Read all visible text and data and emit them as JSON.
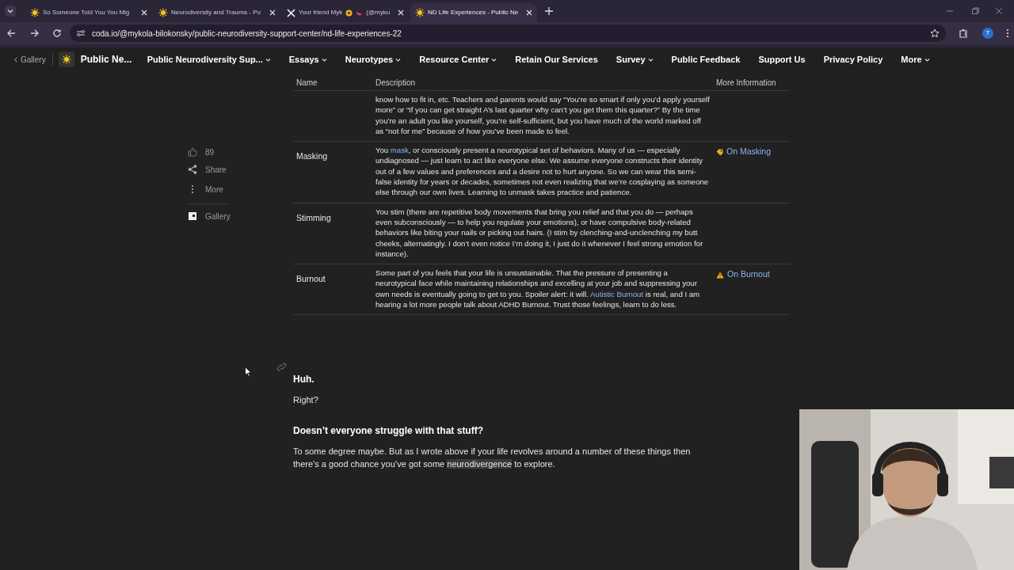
{
  "browser": {
    "tabs": [
      {
        "kind": "sun",
        "title": "So Someone Told You You Mig",
        "selected": false
      },
      {
        "kind": "sun",
        "title": "Neurodiversity and Trauma - Pu",
        "selected": false
      },
      {
        "kind": "x",
        "title": "Your friend Myk",
        "title_suffix": "(@myku",
        "selected": false
      },
      {
        "kind": "sun",
        "title": "ND Life Experiences - Public Ne",
        "selected": true
      }
    ],
    "url": "coda.io/@mykola-bilokonsky/public-neurodiversity-support-center/nd-life-experiences-22",
    "profile_initial": "T"
  },
  "nav": {
    "back_label": "Gallery",
    "doc_title": "Public Ne...",
    "items": [
      {
        "label": "Public Neurodiversity Sup...",
        "dropdown": true
      },
      {
        "label": "Essays",
        "dropdown": true
      },
      {
        "label": "Neurotypes",
        "dropdown": true
      },
      {
        "label": "Resource Center",
        "dropdown": true
      },
      {
        "label": "Retain Our Services",
        "dropdown": false
      },
      {
        "label": "Survey",
        "dropdown": true
      },
      {
        "label": "Public Feedback",
        "dropdown": false
      },
      {
        "label": "Support Us",
        "dropdown": false
      },
      {
        "label": "Privacy Policy",
        "dropdown": false
      },
      {
        "label": "More",
        "dropdown": true
      }
    ]
  },
  "side_actions": {
    "like_count": "89",
    "share": "Share",
    "more": "More",
    "gallery": "Gallery"
  },
  "table": {
    "columns": [
      "Name",
      "Description",
      "More Information"
    ],
    "rows": [
      {
        "description": [
          {
            "kind": "text",
            "text": "know how to fit in, etc. Teachers and parents would say “You’re so smart if only you’d apply yourself more” or “If you can get straight A’s last quarter why can’t you get them this quarter?” By the time you’re an adult you like yourself, you’re self-sufficient, but you have much of the world marked off as “not for me” because of how you’ve been made to feel."
          }
        ]
      },
      {
        "name": "Masking",
        "description": [
          {
            "kind": "text",
            "text": "You "
          },
          {
            "kind": "link",
            "text": "mask"
          },
          {
            "kind": "text",
            "text": ", or consciously present a neurotypical set of behaviors. Many of us — especially undiagnosed — just learn to act like everyone else. We assume everyone constructs their identity out of a few values and preferences and a desire not to hurt anyone. So we can wear this semi-false identity for years or decades, sometimes not even realizing that we’re cosplaying as someone else through our own lives. Learning to unmask takes practice and patience."
          }
        ],
        "info": {
          "kind": "tag",
          "label": "On Masking"
        }
      },
      {
        "name": "Stimming",
        "description": [
          {
            "kind": "text",
            "text": "You stim (there are repetitive body movements that bring you relief and that you do — perhaps even subconsciously — to help you regulate your emotions), or have compulsive body-related behaviors like biting your nails or picking out hairs. (I stim by clenching-and-unclenching my butt cheeks, alternatingly. I don’t even notice I’m doing it, I just do it whenever I feel strong emotion for instance)."
          }
        ]
      },
      {
        "name": "Burnout",
        "description": [
          {
            "kind": "text",
            "text": "Some part of you feels that your life is unsustainable. That the pressure of presenting a neurotypical face while maintaining relationships and excelling at your job and suppressing your own needs is eventually going to get to you. Spoiler alert: it will. "
          },
          {
            "kind": "link",
            "text": "Autistic Burnout"
          },
          {
            "kind": "text",
            "text": " is real, and I am hearing a lot more people talk about ADHD Burnout. Trust those feelings, learn to do less."
          }
        ],
        "info": {
          "kind": "warning",
          "label": "On Burnout"
        }
      }
    ]
  },
  "sections": [
    {
      "kind": "heading",
      "text": "Huh."
    },
    {
      "kind": "paragraph",
      "parts": [
        {
          "kind": "text",
          "text": "Right?"
        }
      ]
    },
    {
      "kind": "subheading",
      "text": "Doesn’t everyone struggle with that stuff?"
    },
    {
      "kind": "paragraph",
      "parts": [
        {
          "kind": "text",
          "text": "To some degree maybe. But as I wrote above if your life revolves around a number of these things then there’s a good chance you’ve got some "
        },
        {
          "kind": "highlight",
          "text": "neurodivergence"
        },
        {
          "kind": "text",
          "text": " to explore."
        }
      ]
    }
  ]
}
